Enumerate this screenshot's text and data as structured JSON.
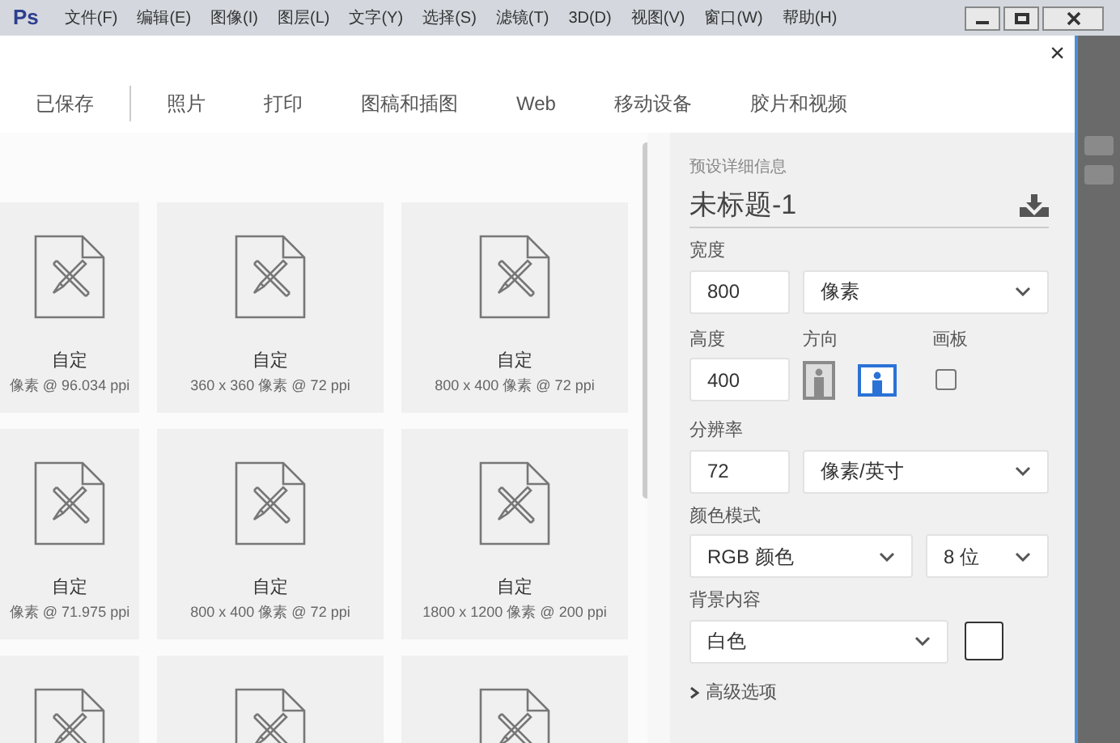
{
  "app": {
    "logo": "Ps",
    "menus": [
      "文件(F)",
      "编辑(E)",
      "图像(I)",
      "图层(L)",
      "文字(Y)",
      "选择(S)",
      "滤镜(T)",
      "3D(D)",
      "视图(V)",
      "窗口(W)",
      "帮助(H)"
    ]
  },
  "dialog": {
    "close": "×",
    "tabs": [
      {
        "label": "已保存",
        "selected": false
      },
      {
        "label": "照片",
        "selected": false
      },
      {
        "label": "打印",
        "selected": false
      },
      {
        "label": "图稿和插图",
        "selected": false
      },
      {
        "label": "Web",
        "selected": false
      },
      {
        "label": "移动设备",
        "selected": false
      },
      {
        "label": "胶片和视频",
        "selected": false
      }
    ],
    "presets": [
      {
        "kind": "full",
        "name": "自定",
        "size": "像素 @ 96.034 ppi"
      },
      {
        "kind": "full",
        "name": "自定",
        "size": "360 x 360 像素 @ 72 ppi"
      },
      {
        "kind": "full",
        "name": "自定",
        "size": "800 x 400 像素 @ 72 ppi"
      },
      {
        "kind": "full",
        "name": "自定",
        "size": "像素 @ 71.975 ppi"
      },
      {
        "kind": "full",
        "name": "自定",
        "size": "800 x 400 像素 @ 72 ppi"
      },
      {
        "kind": "full",
        "name": "自定",
        "size": "1800 x 1200 像素 @ 200 ppi"
      },
      {
        "kind": "icon_only"
      },
      {
        "kind": "icon_only"
      },
      {
        "kind": "icon_only"
      }
    ],
    "details": {
      "heading": "预设详细信息",
      "document_name": "未标题-1",
      "width": {
        "label": "宽度",
        "value": "800",
        "unit": "像素"
      },
      "height": {
        "label": "高度",
        "value": "400"
      },
      "orientation": {
        "label": "方向",
        "options": [
          {
            "kind": "portrait",
            "selected": false
          },
          {
            "kind": "landscape",
            "selected": true
          }
        ]
      },
      "artboard": {
        "label": "画板",
        "checked": false
      },
      "resolution": {
        "label": "分辨率",
        "value": "72",
        "unit": "像素/英寸"
      },
      "color_mode": {
        "label": "颜色模式",
        "mode": "RGB 颜色",
        "depth": "8 位"
      },
      "background": {
        "label": "背景内容",
        "value": "白色",
        "color": "#ffffff"
      },
      "advanced": {
        "label": "高级选项",
        "expanded": false
      }
    }
  }
}
